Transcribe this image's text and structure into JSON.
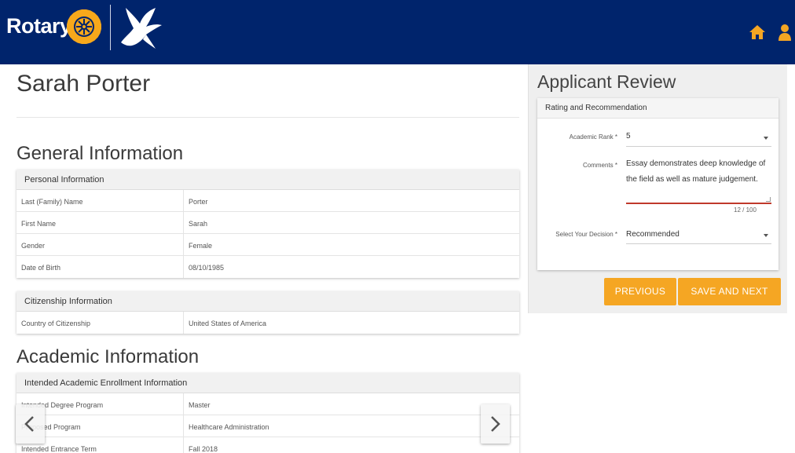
{
  "header": {
    "brand_text": "Rotary",
    "logo_icon": "rotary-wheel-icon",
    "emblem_icon": "dove-icon",
    "home_icon": "home-icon",
    "account_icon": "user-icon",
    "colors": {
      "bar": "#00246c",
      "accent": "#f5a623"
    }
  },
  "applicant": {
    "name": "Sarah Porter"
  },
  "general": {
    "heading": "General Information",
    "personal": {
      "title": "Personal Information",
      "rows": [
        {
          "label": "Last (Family) Name",
          "value": "Porter"
        },
        {
          "label": "First Name",
          "value": "Sarah"
        },
        {
          "label": "Gender",
          "value": "Female"
        },
        {
          "label": "Date of Birth",
          "value": "08/10/1985"
        }
      ]
    },
    "citizenship": {
      "title": "Citizenship Information",
      "rows": [
        {
          "label": "Country of Citizenship",
          "value": "United States of America"
        }
      ]
    }
  },
  "academic": {
    "heading": "Academic Information",
    "enrollment": {
      "title": "Intended Academic Enrollment Information",
      "rows": [
        {
          "label": "Intended Degree Program",
          "value": "Master"
        },
        {
          "label": "Proposed Program",
          "value": "Healthcare Administration"
        },
        {
          "label": "Intended Entrance Term",
          "value": "Fall 2018"
        }
      ]
    }
  },
  "review": {
    "title": "Applicant Review",
    "card_title": "Rating and Recommendation",
    "rank_label": "Academic Rank *",
    "rank_value": "5",
    "comments_label": "Comments *",
    "comments_value": "Essay demonstrates deep knowledge of the field as well as mature judgement.",
    "comments_counter": "12 / 100",
    "decision_label": "Select Your Decision *",
    "decision_value": "Recommended",
    "previous_label": "PREVIOUS",
    "save_next_label": "SAVE AND NEXT"
  },
  "carousel": {
    "prev_icon": "chevron-left-icon",
    "next_icon": "chevron-right-icon"
  }
}
